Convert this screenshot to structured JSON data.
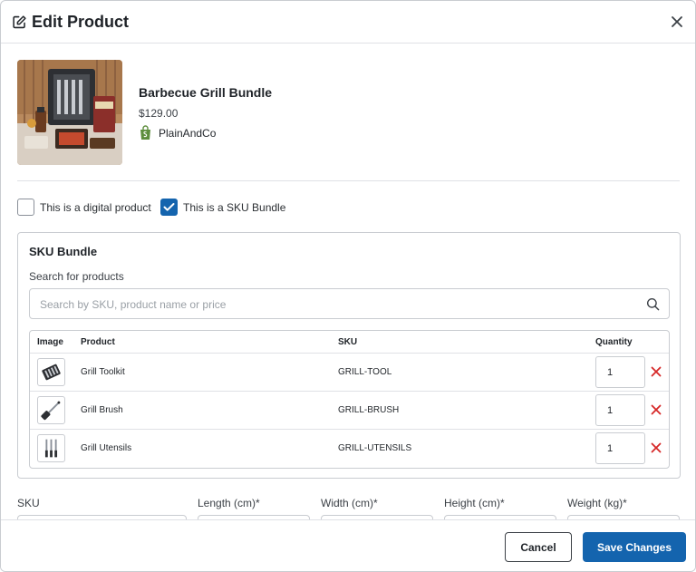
{
  "modal": {
    "title": "Edit Product",
    "edit_icon": "edit-icon",
    "close_icon": "close-icon"
  },
  "product": {
    "name": "Barbecue Grill Bundle",
    "price": "$129.00",
    "store": "PlainAndCo",
    "store_icon": "shopify-bag-icon"
  },
  "options": {
    "digital_label": "This is a digital product",
    "digital_checked": false,
    "bundle_label": "This is a SKU Bundle",
    "bundle_checked": true
  },
  "sku_bundle": {
    "title": "SKU Bundle",
    "search_label": "Search for products",
    "search_placeholder": "Search by SKU, product name or price",
    "search_value": "",
    "columns": [
      "Image",
      "Product",
      "SKU",
      "Quantity"
    ],
    "items": [
      {
        "product": "Grill Toolkit",
        "sku": "GRILL-TOOL",
        "quantity": "1",
        "image_icon": "grill-toolkit-image"
      },
      {
        "product": "Grill Brush",
        "sku": "GRILL-BRUSH",
        "quantity": "1",
        "image_icon": "grill-brush-image"
      },
      {
        "product": "Grill Utensils",
        "sku": "GRILL-UTENSILS",
        "quantity": "1",
        "image_icon": "grill-utensils-image"
      }
    ]
  },
  "fields": {
    "sku_label": "SKU",
    "length_label": "Length (cm)*",
    "width_label": "Width (cm)*",
    "height_label": "Height (cm)*",
    "weight_label": "Weight (kg)*"
  },
  "footer": {
    "cancel_label": "Cancel",
    "save_label": "Save Changes"
  },
  "colors": {
    "primary": "#1464ae",
    "delete": "#d62828",
    "shopify": "#5e8e3e"
  }
}
